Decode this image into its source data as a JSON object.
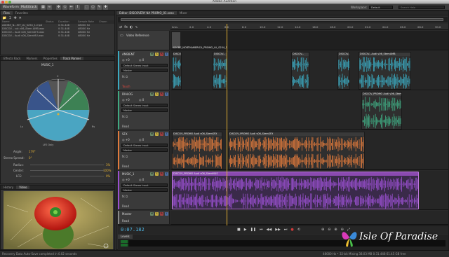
{
  "window": {
    "title": "Adobe Audition"
  },
  "toolbar": {
    "waveform": "Waveform",
    "multitrack": "Multitrack",
    "workspace_label": "Workspace:",
    "workspace_value": "Default",
    "search_placeholder": "Search Help"
  },
  "files_panel": {
    "tabs": [
      "Files",
      "Favorites"
    ],
    "columns": [
      "Name",
      "Status",
      "Duration",
      "Sample Rate",
      "Chann"
    ],
    "rows": [
      {
        "name": "ADOBE_N...HIY_LU_S254_1.mp4",
        "duration": "0:31.448",
        "rate": "48000 Hz"
      },
      {
        "name": "DISCOV... cut v06_Stem AMB.wav",
        "duration": "0:31.448",
        "rate": "48000 Hz"
      },
      {
        "name": "DISCOV... Audi v06_StemSFX.wav",
        "duration": "0:31.448",
        "rate": "48000 Hz"
      },
      {
        "name": "DISCOV... Audi v06_StemMU.wav",
        "duration": "0:31.448",
        "rate": "48000 Hz"
      }
    ]
  },
  "effects_panel": {
    "tabs": [
      "Effects Rack",
      "Markers",
      "Properties",
      "Track Panner"
    ],
    "track": "MUSIC_1",
    "speaker_labels": [
      "L",
      "C",
      "R",
      "Ls",
      "Rs"
    ],
    "lfe_only": "LFE Only",
    "angle_label": "Angle:",
    "angle_value": "179°",
    "stereo_spread_label": "Stereo Spread:",
    "stereo_spread_value": "0°",
    "radius_label": "Radius:",
    "radius_value": "3%",
    "center_label": "Center:",
    "center_value": "100%",
    "lfe_label": "LFE:",
    "lfe_value": "0%"
  },
  "video_panel": {
    "tabs": [
      "History",
      "Video"
    ]
  },
  "editor": {
    "tabs": [
      "Editor: DISCOVERY NA PROMO_01.sesx",
      "Mixer"
    ],
    "timecode": "0:07.182",
    "ruler_ticks": [
      "hms",
      "2.0",
      "4.0",
      "6.0",
      "8.0",
      "10.0",
      "12.0",
      "14.0",
      "16.0",
      "18.0",
      "20.0",
      "22.0",
      "24.0",
      "26.0",
      "28.0",
      "30.0"
    ],
    "video_track": {
      "name": "Video Reference",
      "clip": "ADOBE_NORTHAMERICA_PROMO_LU_S254_1"
    },
    "tracks": [
      {
        "name": "AMBIENT",
        "output": "Default Stereo Input",
        "bus": "Master",
        "mode": "Touch",
        "color": "#3aa9c0",
        "clips": [
          "DISCOV...Cut v06_StemAMB",
          "DISCOV...",
          "DISCOV...",
          "DISCOV...Audi v06_StemAMB"
        ]
      },
      {
        "name": "DIALOG",
        "output": "Default Stereo Input",
        "bus": "Master",
        "mode": "Read",
        "color": "#3fa880",
        "clips": [
          "DISCOV_PROMO Audi v06_StemDIA"
        ]
      },
      {
        "name": "SFX",
        "output": "Default Stereo Input",
        "bus": "Master",
        "mode": "Read",
        "color": "#e07a3c",
        "clips": [
          "DISCOV_PROMO Audi v06_StemSFX",
          "DISCOV_PROMO Audi v06_StemSFX"
        ]
      },
      {
        "name": "MUSIC_1",
        "output": "Default Stereo Input",
        "bus": "Master",
        "mode": "Read",
        "color": "#9a4fd0",
        "clips": [
          "DISCOV_PROMO Audi v06_StemMUS"
        ]
      },
      {
        "name": "Master",
        "output": "",
        "bus": "",
        "mode": "Read",
        "color": "#888888",
        "clips": []
      }
    ],
    "levels_tab": "Levels"
  },
  "statusbar": {
    "left": "Recovery Data Auto-Save completed in 0.02 seconds",
    "right": "48000 Hz • 32-bit Mixing    38.03 MB    0:31.448    61.45 GB free"
  },
  "watermark": "Isle Of Paradise"
}
